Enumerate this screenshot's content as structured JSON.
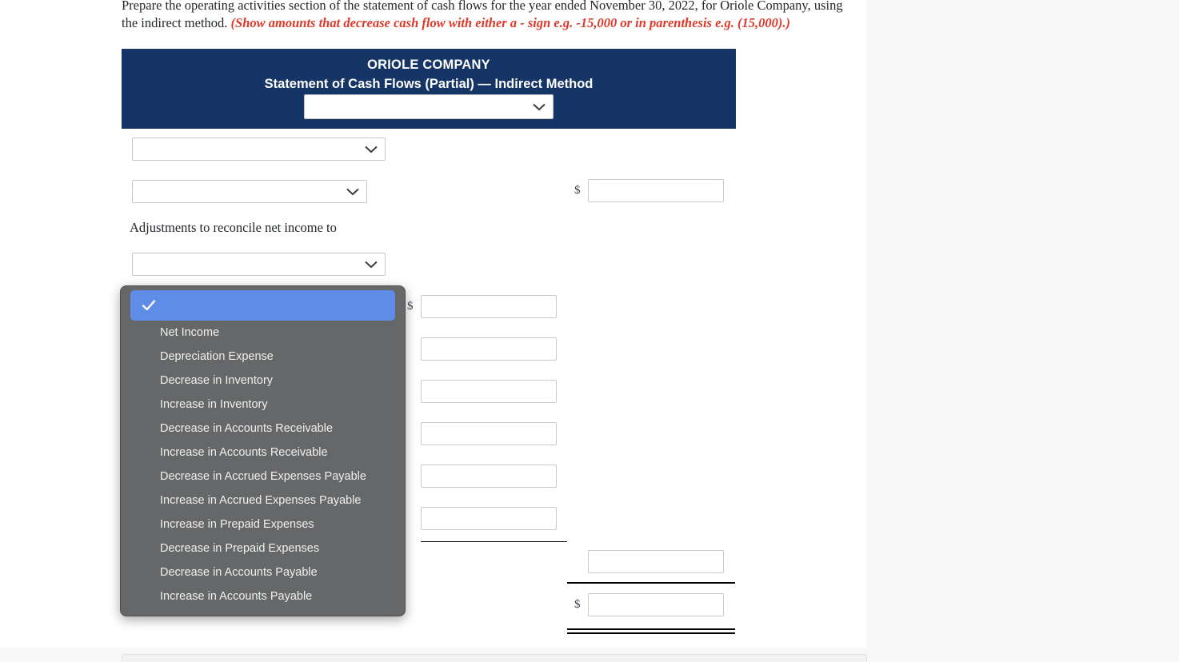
{
  "instructions": {
    "main": "Prepare the operating activities section of the statement of cash flows for the year ended November 30, 2022, for Oriole Company, using the indirect method. ",
    "red_note": "(Show amounts that decrease cash flow with either a - sign e.g. -15,000 or in parenthesis e.g. (15,000).)"
  },
  "statement": {
    "company": "ORIOLE COMPANY",
    "subtitle": "Statement of Cash Flows (Partial) — Indirect Method",
    "header_select_value": "",
    "adjustments_label": "Adjustments to reconcile net income to",
    "dollar_sign": "$"
  },
  "selects": {
    "header": "",
    "row1": "",
    "row2": "",
    "row3": "",
    "row4": "",
    "row5": "",
    "row6": "",
    "row7": "",
    "row8": "",
    "row9": "",
    "row10": "",
    "row11": ""
  },
  "inputs": {
    "net_income_amount": "",
    "adj1": "",
    "adj2": "",
    "adj3": "",
    "adj4": "",
    "adj5": "",
    "adj6": "",
    "subtotal": "",
    "total": "",
    "placeholder": ""
  },
  "dropdown": {
    "selected_index": 0,
    "options": [
      "",
      "Net Income",
      "Depreciation Expense",
      "Decrease in Inventory",
      "Increase in Inventory",
      "Decrease in Accounts Receivable",
      "Increase in Accounts Receivable",
      "Decrease in Accrued Expenses Payable",
      "Increase in Accrued Expenses Payable",
      "Increase in Prepaid Expenses",
      "Decrease in Prepaid Expenses",
      "Decrease in Accounts Payable",
      "Increase in Accounts Payable"
    ]
  },
  "colors": {
    "header_navy": "#153566",
    "note_red": "#e0392a",
    "dropdown_bg": "#666768",
    "dropdown_highlight": "#5e8ce6",
    "page_bg": "#f8f8f8"
  }
}
